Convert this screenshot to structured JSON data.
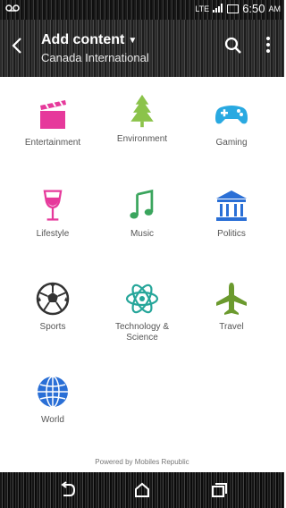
{
  "status_bar": {
    "left_icon": "voicemail-icon",
    "network": "LTE",
    "time": "6:50",
    "ampm": "AM"
  },
  "header": {
    "title": "Add content",
    "subtitle": "Canada International"
  },
  "categories": [
    {
      "label": "Entertainment",
      "icon": "clapperboard-icon",
      "color": "#e6399b"
    },
    {
      "label": "Environment",
      "icon": "tree-icon",
      "color": "#8bc34a"
    },
    {
      "label": "Gaming",
      "icon": "gamepad-icon",
      "color": "#29a9e1"
    },
    {
      "label": "Lifestyle",
      "icon": "wine-glass-icon",
      "color": "#e6399b"
    },
    {
      "label": "Music",
      "icon": "music-note-icon",
      "color": "#3aa55d"
    },
    {
      "label": "Politics",
      "icon": "government-building-icon",
      "color": "#2a6fd6"
    },
    {
      "label": "Sports",
      "icon": "soccer-ball-icon",
      "color": "#333333"
    },
    {
      "label": "Technology & Science",
      "icon": "atom-icon",
      "color": "#26a69a"
    },
    {
      "label": "Travel",
      "icon": "airplane-icon",
      "color": "#6b9a2e"
    },
    {
      "label": "World",
      "icon": "globe-icon",
      "color": "#2a6fd6"
    }
  ],
  "footer": {
    "powered_by": "Powered by Mobiles Republic"
  }
}
